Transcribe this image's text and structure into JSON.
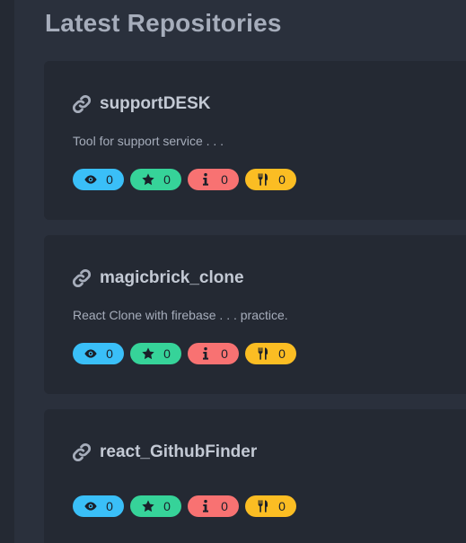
{
  "page": {
    "title": "Latest Repositories"
  },
  "repos": [
    {
      "name": "supportDESK",
      "description": "Tool for support service . . .",
      "watchers": "0",
      "stars": "0",
      "issues": "0",
      "forks": "0"
    },
    {
      "name": "magicbrick_clone",
      "description": "React Clone with firebase . . . practice.",
      "watchers": "0",
      "stars": "0",
      "issues": "0",
      "forks": "0"
    },
    {
      "name": "react_GithubFinder",
      "description": "",
      "watchers": "0",
      "stars": "0",
      "issues": "0",
      "forks": "0"
    }
  ],
  "icons": {
    "repo_link": "link-icon",
    "watchers": "eye-icon",
    "stars": "star-icon",
    "issues": "info-icon",
    "forks": "utensils-icon"
  },
  "colors": {
    "background": "#2a303c",
    "card": "#242933",
    "watchers": "#3abff8",
    "stars": "#36d399",
    "issues": "#f87272",
    "forks": "#fbbd23"
  }
}
